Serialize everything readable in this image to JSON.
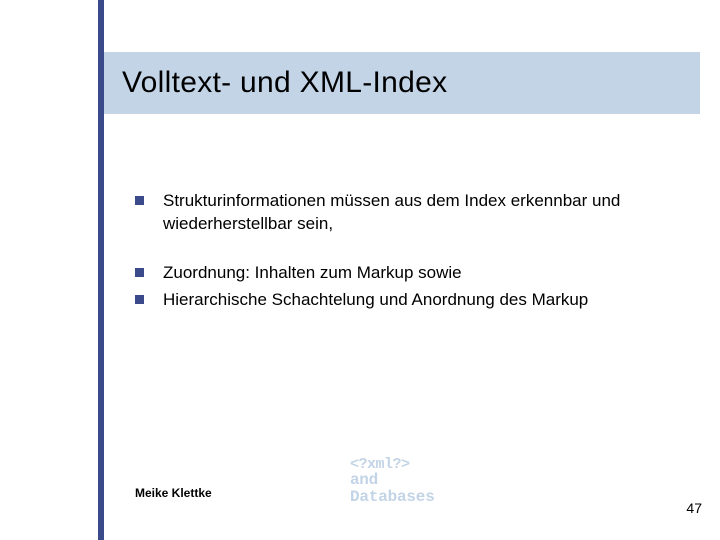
{
  "title": "Volltext- und XML-Index",
  "bullets": [
    "Strukturinformationen müssen aus dem Index erkennbar und wiederherstellbar sein,",
    "Zuordnung: Inhalten zum Markup sowie",
    "Hierarchische Schachtelung und Anordnung des Markup"
  ],
  "footer": {
    "author": "Meike Klettke",
    "page": "47"
  },
  "logo": {
    "line1": "<?xml?>",
    "line2": "and",
    "line3": "Databases"
  },
  "colors": {
    "accent": "#3a4a8a",
    "band": "#c3d4e7"
  }
}
